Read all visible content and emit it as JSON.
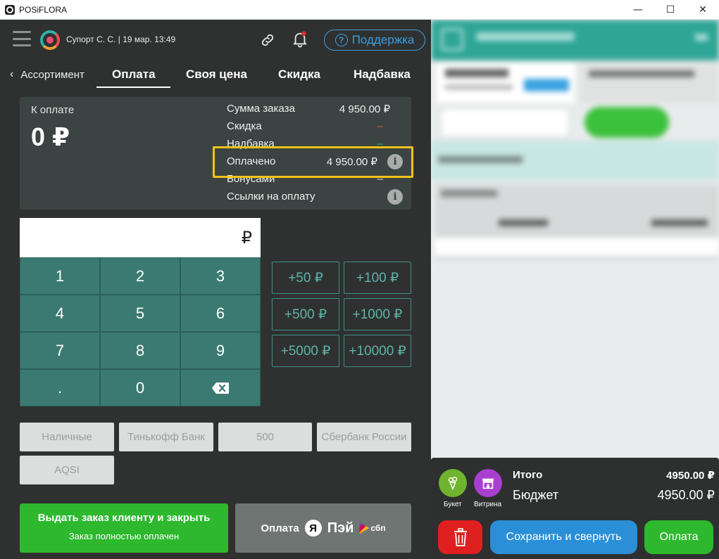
{
  "window": {
    "title": "POSiFLORA",
    "minimize": "—",
    "maximize": "☐",
    "close": "✕"
  },
  "header": {
    "user_info": "Супорт С. С. | 19 мар. 13:49",
    "support_label": "Поддержка",
    "support_icon": "?"
  },
  "tabs": {
    "back_label": "Ассортимент",
    "items": [
      "Оплата",
      "Своя цена",
      "Скидка",
      "Надбавка"
    ],
    "active": "Оплата"
  },
  "summary": {
    "to_pay_label": "К оплате",
    "to_pay_value": "0 ₽",
    "rows": {
      "order_sum_label": "Сумма заказа",
      "order_sum_value": "4 950.00 ₽",
      "discount_label": "Скидка",
      "discount_value": "–",
      "markup_label": "Надбавка",
      "markup_value": "–",
      "paid_label": "Оплачено",
      "paid_value": "4 950.00 ₽",
      "bonus_label": "Бонусами",
      "bonus_value": "–",
      "links_label": "Ссылки на оплату"
    },
    "info_glyph": "i"
  },
  "amount_input": {
    "currency": "₽"
  },
  "keypad": {
    "keys": [
      "1",
      "2",
      "3",
      "4",
      "5",
      "6",
      "7",
      "8",
      "9",
      ".",
      "0"
    ]
  },
  "quick_amounts": [
    "+50 ₽",
    "+100 ₽",
    "+500 ₽",
    "+1000 ₽",
    "+5000 ₽",
    "+10000 ₽"
  ],
  "payment_methods": [
    "Наличные",
    "Тинькофф Банк",
    "500",
    "Сбербанк России",
    "AQSI"
  ],
  "actions": {
    "close_order_title": "Выдать заказ клиенту и закрыть",
    "close_order_subtitle": "Заказ полностью оплачен",
    "yapay_label": "Оплата",
    "yapay_ya": "Я",
    "yapay_pay": "Пэй",
    "sbp_label": "сбп"
  },
  "bottom_panel": {
    "category_bouquet": "Букет",
    "category_showcase": "Витрина",
    "total_label": "Итого",
    "total_value": "4950.00 ₽",
    "budget_label": "Бюджет",
    "budget_value": "4950.00 ₽",
    "save_label": "Сохранить и свернуть",
    "pay_label": "Оплата"
  },
  "colors": {
    "accent_teal": "#3b7a72",
    "highlight": "#f3c21b",
    "success": "#2db82e",
    "support_blue": "#3d9de0",
    "danger": "#e02020"
  }
}
